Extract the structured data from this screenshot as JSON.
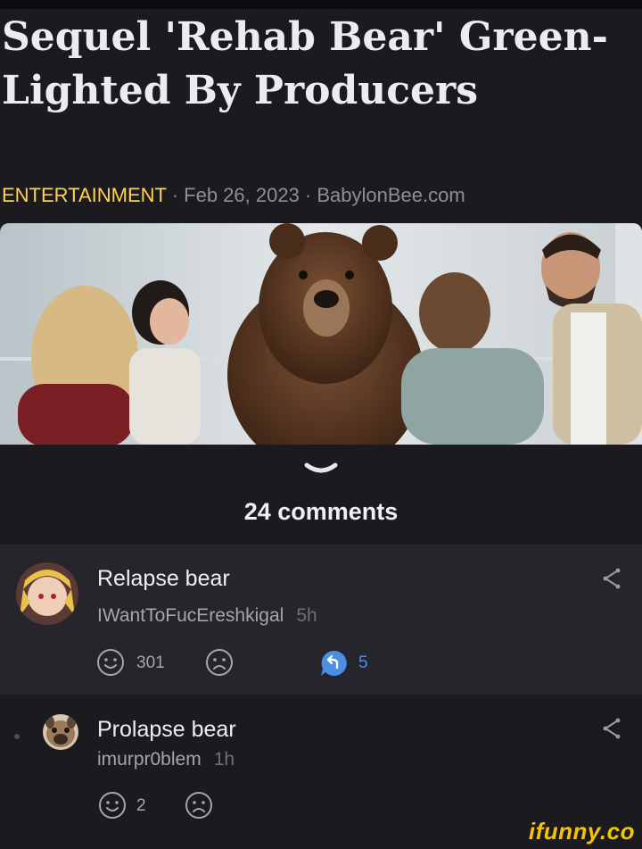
{
  "article": {
    "headline": "Sequel 'Rehab Bear' Green-Lighted By Producers",
    "category": "ENTERTAINMENT",
    "date": "Feb 26, 2023",
    "source": "BabylonBee.com",
    "separator": " · "
  },
  "comments_section": {
    "count_label": "24 comments",
    "items": [
      {
        "text": "Relapse bear",
        "username": "IWantToFucEreshkigal",
        "time": "5h",
        "likes": "301",
        "replies": "5"
      },
      {
        "text": "Prolapse bear",
        "username": "imurpr0blem",
        "time": "1h",
        "likes": "2"
      }
    ]
  },
  "watermark": "ifunny.co",
  "colors": {
    "category": "#ffd34d",
    "reply_accent": "#4a8fe7",
    "watermark": "#f5c400"
  },
  "icons": [
    "chevron-down-icon",
    "share-icon",
    "smile-icon",
    "frown-icon",
    "reply-icon"
  ]
}
